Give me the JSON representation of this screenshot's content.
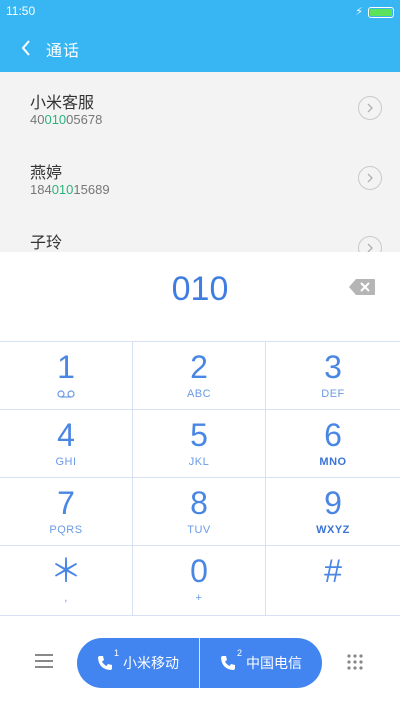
{
  "status_bar": {
    "time": "11:50"
  },
  "header": {
    "title": "通话"
  },
  "results": [
    {
      "name": "小米客服",
      "number_pre": "40",
      "number_match": "010",
      "number_post": "05678"
    },
    {
      "name": "燕婷",
      "number_pre": "184",
      "number_match": "010",
      "number_post": "15689"
    },
    {
      "name": "子玲"
    }
  ],
  "entry": {
    "number": "010"
  },
  "keypad": [
    {
      "digit": "1",
      "sub": ""
    },
    {
      "digit": "2",
      "sub": "ABC"
    },
    {
      "digit": "3",
      "sub": "DEF"
    },
    {
      "digit": "4",
      "sub": "GHI"
    },
    {
      "digit": "5",
      "sub": "JKL"
    },
    {
      "digit": "6",
      "sub": "MNO"
    },
    {
      "digit": "7",
      "sub": "PQRS"
    },
    {
      "digit": "8",
      "sub": "TUV"
    },
    {
      "digit": "9",
      "sub": "WXYZ"
    },
    {
      "digit": "＊",
      "sub": ","
    },
    {
      "digit": "0",
      "sub": "+"
    },
    {
      "digit": "#",
      "sub": ""
    }
  ],
  "call_buttons": [
    {
      "label": "小米移动",
      "sim": "1"
    },
    {
      "label": "中国电信",
      "sim": "2"
    }
  ],
  "colors": {
    "header": "#38b6f4",
    "accent": "#4285f0",
    "match": "#2cb37d"
  },
  "icons": [
    "back-icon",
    "detail-arrow-icon",
    "backspace-icon",
    "voicemail-icon",
    "menu-icon",
    "phone-sim-icon",
    "dialpad-grid-icon"
  ]
}
